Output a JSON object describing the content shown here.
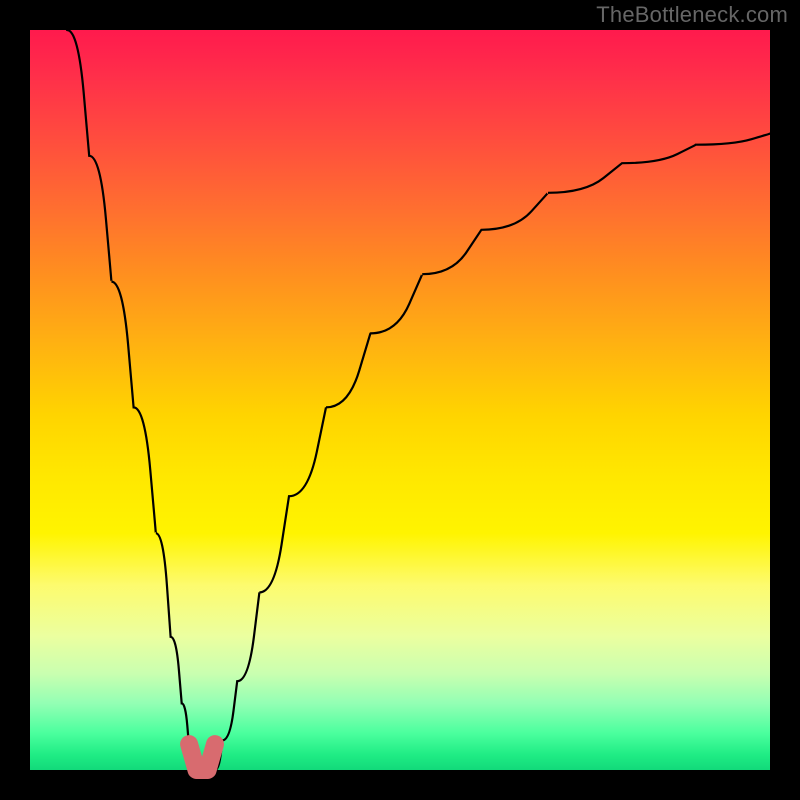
{
  "watermark": "TheBottleneck.com",
  "colors": {
    "u_shape_stroke": "#d86b6f",
    "curve_stroke": "#000000"
  },
  "chart_data": {
    "type": "line",
    "title": "",
    "xlabel": "",
    "ylabel": "",
    "xlim": [
      0,
      100
    ],
    "ylim": [
      0,
      100
    ],
    "grid": false,
    "legend": false,
    "note": "Axes are unlabeled; x and y values are estimated positions in percent of the plot area (0,0 = bottom-left, 100,100 = top-right). The U-shaped marker near x≈22–25 indicates the optimal (near-zero) region.",
    "series": [
      {
        "name": "left descending branch",
        "x": [
          5,
          8,
          11,
          14,
          17,
          19,
          20.5,
          21.5,
          22
        ],
        "y": [
          100,
          83,
          66,
          49,
          32,
          18,
          9,
          3,
          0
        ]
      },
      {
        "name": "right ascending branch",
        "x": [
          25,
          26,
          28,
          31,
          35,
          40,
          46,
          53,
          61,
          70,
          80,
          90,
          100
        ],
        "y": [
          0,
          4,
          12,
          24,
          37,
          49,
          59,
          67,
          73,
          78,
          82,
          84.5,
          86
        ]
      },
      {
        "name": "optimal U marker",
        "x": [
          21.5,
          22.5,
          24,
          25
        ],
        "y": [
          3.5,
          0,
          0,
          3.5
        ]
      }
    ]
  }
}
